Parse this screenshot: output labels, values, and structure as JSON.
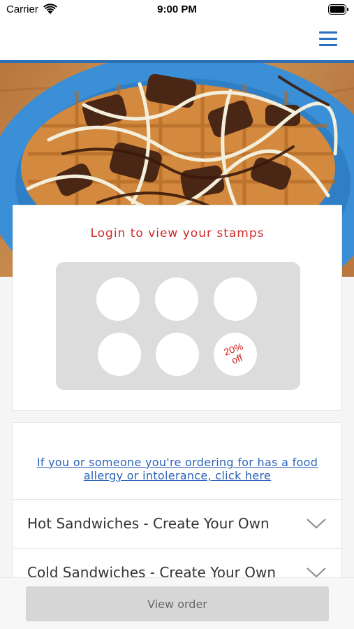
{
  "status_bar": {
    "carrier": "Carrier",
    "time": "9:00 PM",
    "wifi_icon": "wifi-icon",
    "battery_icon": "battery-icon"
  },
  "nav": {
    "menu_icon": "hamburger-menu-icon",
    "accent_color": "#2a6ebd"
  },
  "hero": {
    "image": "waffle-with-chocolate-drizzle-photo"
  },
  "stamps": {
    "login_text": "Login to view your stamps",
    "total_stamps": 6,
    "collected": 0,
    "reward_line1": "20%",
    "reward_line2": "off",
    "reward_color": "#cc1f1f"
  },
  "menu": {
    "allergy_line1": "If you or someone you're ordering for has a food",
    "allergy_line2": "allergy or intolerance, click here",
    "categories": [
      {
        "label": "Hot Sandwiches - Create Your Own"
      },
      {
        "label": "Cold Sandwiches - Create Your Own"
      }
    ]
  },
  "footer": {
    "view_order_label": "View order"
  }
}
